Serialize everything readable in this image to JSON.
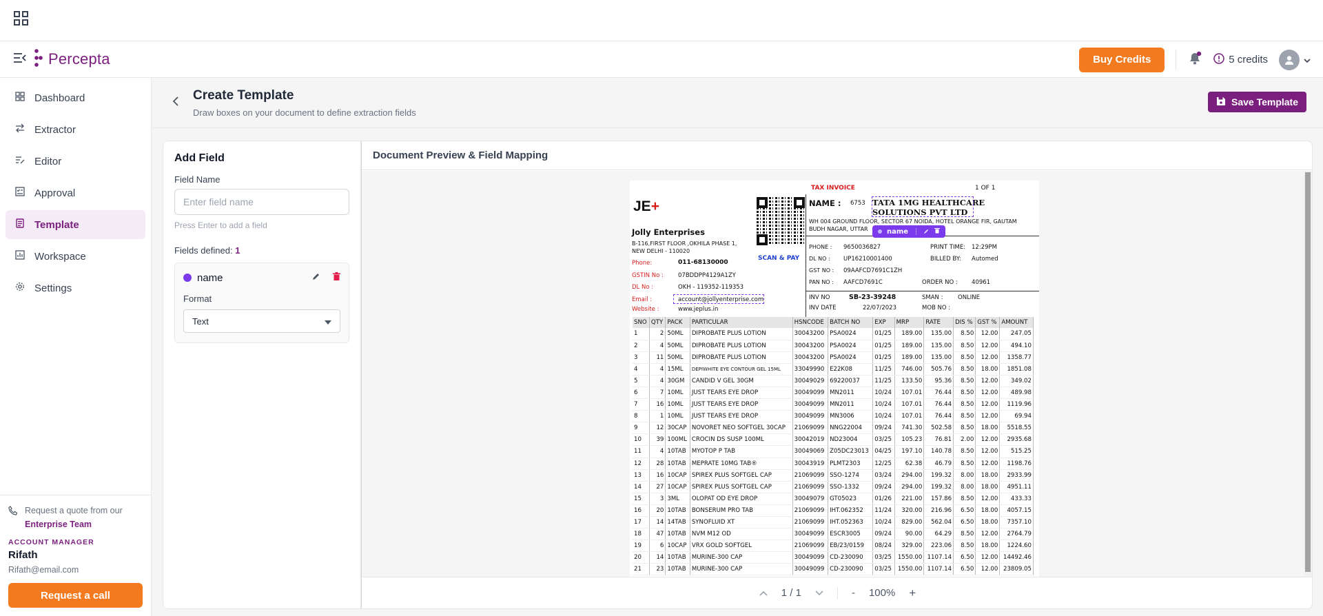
{
  "header": {
    "brand": "Percepta",
    "buy_credits": "Buy Credits",
    "credits": "5 credits"
  },
  "sidebar": {
    "items": [
      {
        "label": "Dashboard"
      },
      {
        "label": "Extractor"
      },
      {
        "label": "Editor"
      },
      {
        "label": "Approval"
      },
      {
        "label": "Template"
      },
      {
        "label": "Workspace"
      },
      {
        "label": "Settings"
      }
    ],
    "quote_text": "Request a quote from our",
    "quote_link": "Enterprise Team",
    "account_manager_label": "ACCOUNT MANAGER",
    "account_manager_name": "Rifath",
    "account_manager_email": "Rifath@email.com",
    "request_call": "Request a call"
  },
  "page": {
    "title": "Create Template",
    "subtitle": "Draw boxes on your document to define extraction fields",
    "save_label": "Save Template"
  },
  "add_field": {
    "title": "Add Field",
    "field_name_label": "Field Name",
    "field_name_placeholder": "Enter field name",
    "hint": "Press Enter to add a field",
    "fields_defined_label": "Fields defined:",
    "fields_defined_count": "1",
    "field": {
      "name": "name",
      "format_label": "Format",
      "format_value": "Text",
      "color": "#7c3aed"
    }
  },
  "preview": {
    "title": "Document Preview & Field Mapping",
    "page_indicator": "1 / 1",
    "zoom": "100%",
    "zoom_minus": "-",
    "zoom_plus": "+"
  },
  "invoice": {
    "title": "TAX INVOICE",
    "page_of": "1 OF   1",
    "logo": "JE",
    "company": "Jolly Enterprises",
    "address1": "B-116,FIRST FLOOR ,OKHILA PHASE 1,",
    "address2": "NEW DELHI - 110020",
    "scan_pay": "SCAN & PAY",
    "phone_label": "Phone:",
    "phone": "011-68130000",
    "gstin_label": "GSTIN No :",
    "gstin": "07BDDPP4129A1ZY",
    "dl_label": "DL No :",
    "dl": "OKH - 119352-119353",
    "email_label": "Email :",
    "email": "account@jollyenterprise.com",
    "website_label": "Website :",
    "website": "www.jeplus.in",
    "name_label": "NAME  :",
    "name_code": "6753",
    "customer1": "TATA 1MG HEALTHCARE",
    "customer2": "SOLUTIONS PVT LTD",
    "cust_addr1": "WH 004 GROUND FLOOR, SECTOR 67 NOIDA, HOTEL ORANGE FIR, GAUTAM",
    "cust_addr2": "BUDH NAGAR, UTTAR",
    "c_phone_label": "PHONE  :",
    "c_phone": "9650036827",
    "print_time_label": "PRINT TIME:",
    "print_time": "12:29PM",
    "c_dl_label": "DL NO   :",
    "c_dl": "UP16210001400",
    "billed_by_label": "BILLED BY:",
    "billed_by": "Automed",
    "gst_label": "GST NO :",
    "gst": "09AAFCD7691C1ZH",
    "pan_label": "PAN NO  :",
    "pan": "AAFCD7691C",
    "order_label": "ORDER NO  :",
    "order": "40961",
    "inv_no_label": "INV NO",
    "inv_no": "SB-23-39248",
    "sman_label": "SMAN   :",
    "sman": "ONLINE",
    "inv_date_label": "INV DATE",
    "inv_date": "22/07/2023",
    "mob_label": "MOB NO  :",
    "columns": [
      "SNO",
      "QTY",
      "PACK",
      "PARTICULAR",
      "HSNCODE",
      "BATCH NO",
      "EXP",
      "MRP",
      "RATE",
      "DIS %",
      "GST %",
      "AMOUNT"
    ],
    "rows": [
      [
        "1",
        "2",
        "50ML",
        "DIPROBATE PLUS LOTION",
        "30043200",
        "PSA0024",
        "01/25",
        "189.00",
        "135.00",
        "8.50",
        "12.00",
        "247.05"
      ],
      [
        "2",
        "4",
        "50ML",
        "DIPROBATE PLUS LOTION",
        "30043200",
        "PSA0024",
        "01/25",
        "189.00",
        "135.00",
        "8.50",
        "12.00",
        "494.10"
      ],
      [
        "3",
        "11",
        "50ML",
        "DIPROBATE PLUS LOTION",
        "30043200",
        "PSA0024",
        "01/25",
        "189.00",
        "135.00",
        "8.50",
        "12.00",
        "1358.77"
      ],
      [
        "4",
        "4",
        "15ML",
        "DEPIWHITE EYE CONTOUR GEL 15ML",
        "33049990",
        "E22K08",
        "11/25",
        "746.00",
        "505.76",
        "8.50",
        "18.00",
        "1851.08"
      ],
      [
        "5",
        "4",
        "30GM",
        "CANDID V GEL 30GM",
        "30049029",
        "69220037",
        "11/25",
        "133.50",
        "95.36",
        "8.50",
        "12.00",
        "349.02"
      ],
      [
        "6",
        "7",
        "10ML",
        "JUST TEARS EYE DROP",
        "30049099",
        "MN2011",
        "10/24",
        "107.01",
        "76.44",
        "8.50",
        "12.00",
        "489.98"
      ],
      [
        "7",
        "16",
        "10ML",
        "JUST TEARS EYE DROP",
        "30049099",
        "MN2011",
        "10/24",
        "107.01",
        "76.44",
        "8.50",
        "12.00",
        "1119.96"
      ],
      [
        "8",
        "1",
        "10ML",
        "JUST TEARS EYE DROP",
        "30049099",
        "MN3006",
        "10/24",
        "107.01",
        "76.44",
        "8.50",
        "12.00",
        "69.94"
      ],
      [
        "9",
        "12",
        "30CAP",
        "NOVORET NEO SOFTGEL 30CAP",
        "21069099",
        "NNG22004",
        "09/24",
        "741.30",
        "502.58",
        "8.50",
        "18.00",
        "5518.55"
      ],
      [
        "10",
        "39",
        "100ML",
        "CROCIN DS SUSP 100ML",
        "30042019",
        "ND23004",
        "03/25",
        "105.23",
        "76.81",
        "2.00",
        "12.00",
        "2935.68"
      ],
      [
        "11",
        "4",
        "10TAB",
        "MYOTOP P TAB",
        "30049069",
        "Z05DC23013",
        "04/25",
        "197.10",
        "140.78",
        "8.50",
        "12.00",
        "515.25"
      ],
      [
        "12",
        "28",
        "10TAB",
        "MEPRATE 10MG TAB®",
        "30043919",
        "PLMT2303",
        "12/25",
        "62.38",
        "46.79",
        "8.50",
        "12.00",
        "1198.76"
      ],
      [
        "13",
        "16",
        "10CAP",
        "SPIREX PLUS SOFTGEL CAP",
        "21069099",
        "SSO-1274",
        "03/24",
        "294.00",
        "199.32",
        "8.00",
        "18.00",
        "2933.99"
      ],
      [
        "14",
        "27",
        "10CAP",
        "SPIREX PLUS SOFTGEL CAP",
        "21069099",
        "SSO-1332",
        "09/24",
        "294.00",
        "199.32",
        "8.00",
        "18.00",
        "4951.11"
      ],
      [
        "15",
        "3",
        "3ML",
        "OLOPAT OD EYE DROP",
        "30049079",
        "GT05023",
        "01/26",
        "221.00",
        "157.86",
        "8.50",
        "12.00",
        "433.33"
      ],
      [
        "16",
        "20",
        "10TAB",
        "BONSERUM PRO TAB",
        "21069099",
        "IHT.062352",
        "11/24",
        "320.00",
        "216.96",
        "6.50",
        "18.00",
        "4057.15"
      ],
      [
        "17",
        "14",
        "14TAB",
        "SYNOFLUID XT",
        "21069099",
        "IHT.052363",
        "10/24",
        "829.00",
        "562.04",
        "6.50",
        "18.00",
        "7357.10"
      ],
      [
        "18",
        "47",
        "10TAB",
        "NVM  M12 OD",
        "30049099",
        "ESCR3005",
        "09/24",
        "90.00",
        "64.29",
        "8.50",
        "12.00",
        "2764.79"
      ],
      [
        "19",
        "6",
        "10CAP",
        "VRX GOLD SOFTGEL",
        "21069099",
        "EB/23/0159",
        "08/24",
        "329.00",
        "223.06",
        "8.50",
        "18.00",
        "1224.60"
      ],
      [
        "20",
        "14",
        "10TAB",
        "MURINE-300 CAP",
        "30049099",
        "CD-230090",
        "03/25",
        "1550.00",
        "1107.14",
        "6.50",
        "12.00",
        "14492.46"
      ],
      [
        "21",
        "23",
        "10TAB",
        "MURINE-300 CAP",
        "30049099",
        "CD-230090",
        "03/25",
        "1550.00",
        "1107.14",
        "6.50",
        "12.00",
        "23809.05"
      ]
    ]
  },
  "field_tag": {
    "label": "name"
  }
}
